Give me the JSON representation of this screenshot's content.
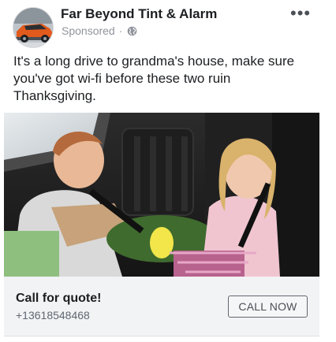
{
  "header": {
    "page_name": "Far Beyond Tint & Alarm",
    "sponsored": "Sponsored",
    "separator": "·",
    "privacy_icon": "globe-icon",
    "more_label": "•••"
  },
  "post": {
    "text": "It's a long drive to grandma's house, make sure you've got wi-fi before these two ruin Thanksgiving."
  },
  "cta": {
    "title": "Call for quote!",
    "phone": "+13618548468",
    "button_label": "CALL NOW"
  },
  "colors": {
    "secondary_text": "#90949c",
    "cta_background": "#f2f3f5",
    "button_border": "#606770"
  }
}
